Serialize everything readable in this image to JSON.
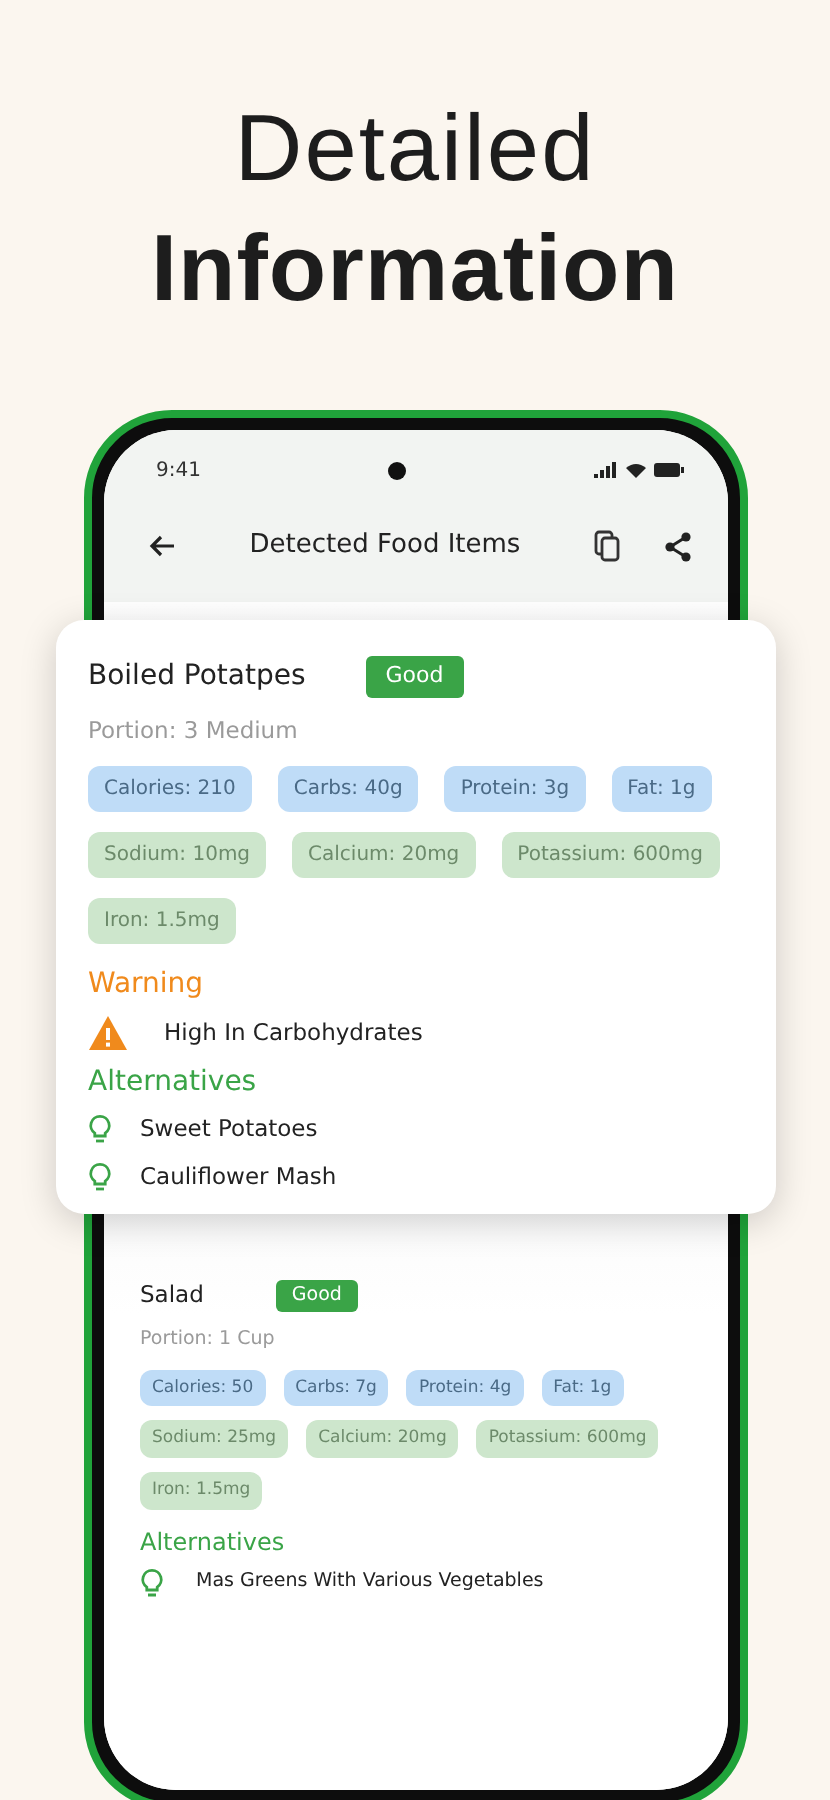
{
  "headline": {
    "line_1": "Detailed",
    "line_2": "Information"
  },
  "status_bar": {
    "time": "9:41"
  },
  "app_bar": {
    "title": "Detected Food Items"
  },
  "food_items": [
    {
      "name": "Boiled Potatpes",
      "rating": "Good",
      "portion": "Portion: 3 Medium",
      "macros": [
        "Calories: 210",
        "Carbs: 40g",
        "Protein: 3g",
        "Fat: 1g"
      ],
      "minerals": [
        "Sodium: 10mg",
        "Calcium: 20mg",
        "Potassium: 600mg",
        "Iron: 1.5mg"
      ],
      "warning": {
        "heading": "Warning",
        "items": [
          "High In Carbohydrates"
        ]
      },
      "alternatives": {
        "heading": "Alternatives",
        "items": [
          "Sweet Potatoes",
          "Cauliflower Mash"
        ]
      }
    },
    {
      "name": "Salad",
      "rating": "Good",
      "portion": "Portion: 1 Cup",
      "macros": [
        "Calories: 50",
        "Carbs: 7g",
        "Protein: 4g",
        "Fat: 1g"
      ],
      "minerals": [
        "Sodium: 25mg",
        "Calcium: 20mg",
        "Potassium: 600mg",
        "Iron: 1.5mg"
      ],
      "alternatives": {
        "heading": "Alternatives",
        "items": [
          "Mas Greens With Various Vegetables"
        ]
      }
    }
  ]
}
